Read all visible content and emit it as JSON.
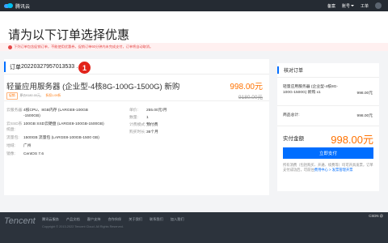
{
  "nav": {
    "logo_text": "腾讯云",
    "links": [
      "备案",
      "账号",
      "工单"
    ],
    "account": "账号"
  },
  "header": {
    "title": "请为以下订单选择优惠",
    "notice": "下列订单包含促销订单，不能使用优惠券，促销订单60分钟内未完成支付，订单将自动取消。"
  },
  "order": {
    "id_label": "订单",
    "id_value": "20220327957013533 … 81",
    "marker": "1",
    "product_name": "轻量应用服务器 (企业型-4核8G-100G-1500G) 新购",
    "price": "998.00元",
    "orig_price": "9180.00元",
    "tag": "促销",
    "tag_info": "原价9180.00元，",
    "tag_info2": "折扣1.09折",
    "specs_left": [
      {
        "key": "云服务器:",
        "value": "4核CPU、8GB内存 (LARGE8-100GB -1500GB)"
      },
      {
        "key": "云SSD系统盘:",
        "value": "100GB SSD云硬盘 (LARGE8-100GB-1500GB)"
      },
      {
        "key": "流量包:",
        "value": "1500GB 流量包 (LARGE8-100GB-1500 GB)"
      },
      {
        "key": "地域:",
        "value": "广州"
      },
      {
        "key": "镜像:",
        "value": "CentOS 7.6"
      }
    ],
    "specs_right": [
      {
        "key": "单价:",
        "value": "255.00元/月"
      },
      {
        "key": "数量:",
        "value": "1"
      },
      {
        "key": "计费模式:",
        "value": "预付费"
      },
      {
        "key": "购买时长:",
        "value": "36个月"
      }
    ]
  },
  "summary": {
    "title": "核对订单",
    "item_name": "轻量应用服务器 (企业型-4核8G-100G-1500G) 新购 x1",
    "item_value": "998.00元",
    "total_label": "商品总计:",
    "total_value": "998.00元",
    "real_label": "实付金额",
    "real_value": "998.00元",
    "pay_button": "立即支付",
    "note_prefix": "所有消费（包括购买、开通、续费等）均可开具发票，订单支付成功后，可前往",
    "note_link": "费用中心 > 发票管理开票",
    "note_suffix": ""
  },
  "footer": {
    "logo": "Tencent",
    "links": [
      "腾讯云服务",
      "产品文档",
      "客户支持",
      "合作伙伴",
      "关于我们",
      "联系我们",
      "加入我们"
    ],
    "copyright": "Copyright © 2013-2022 Tencent Cloud. All Rights Reserved.",
    "csdn": "CSDN @"
  },
  "colors": {
    "accent": "#006eff",
    "price": "#ff7200",
    "notice": "#e54545",
    "marker": "#e2231a"
  }
}
